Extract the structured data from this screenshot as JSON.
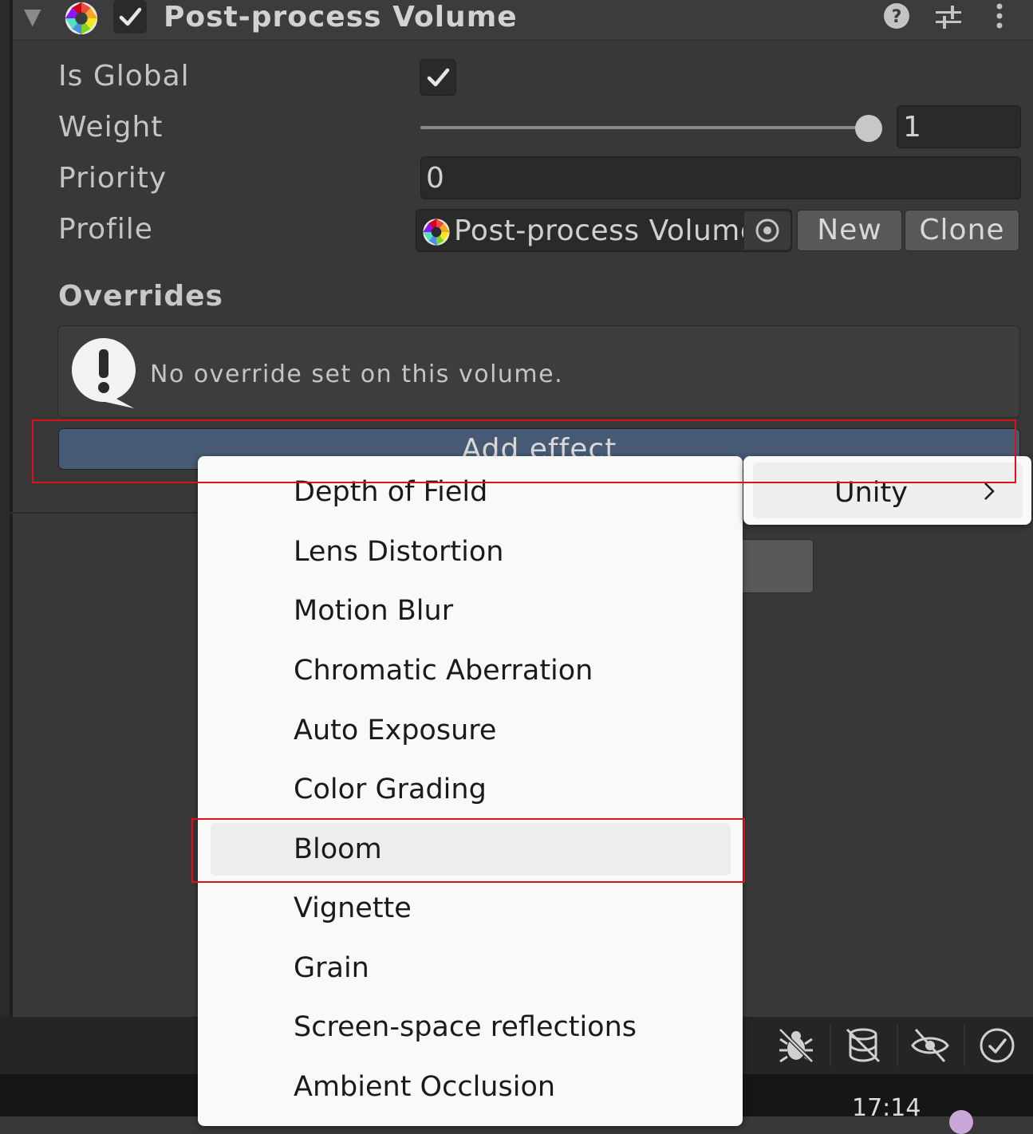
{
  "component": {
    "title": "Post-process Volume",
    "enabled": true
  },
  "fields": {
    "is_global_label": "Is Global",
    "is_global_checked": true,
    "weight_label": "Weight",
    "weight_value": "1",
    "weight_fraction": 1,
    "priority_label": "Priority",
    "priority_value": "0",
    "profile_label": "Profile",
    "profile_value": "Post-process Volume Profile",
    "new_label": "New",
    "clone_label": "Clone"
  },
  "overrides": {
    "heading": "Overrides",
    "help_text": "No override set on this volume.",
    "add_effect_label": "Add effect"
  },
  "menu": {
    "items": [
      "Depth of Field",
      "Lens Distortion",
      "Motion Blur",
      "Chromatic Aberration",
      "Auto Exposure",
      "Color Grading",
      "Bloom",
      "Vignette",
      "Grain",
      "Screen-space reflections",
      "Ambient Occlusion"
    ],
    "highlighted": "Bloom",
    "submenu_label": "Unity"
  },
  "status_bar": {
    "icons": [
      "bug-icon",
      "database-icon",
      "eye-icon",
      "check-circle-icon"
    ],
    "time": "17:14"
  },
  "colors": {
    "accent_button": "#475a73",
    "highlight_box": "#e0101a"
  }
}
